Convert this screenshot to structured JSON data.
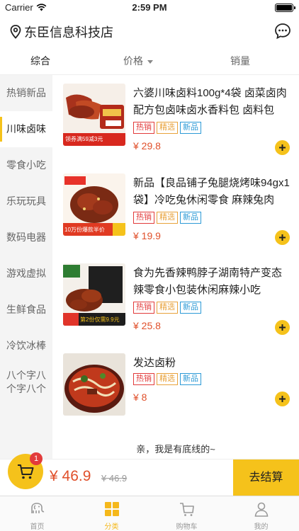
{
  "status": {
    "carrier": "Carrier",
    "time": "2:59 PM"
  },
  "header": {
    "store_name": "东臣信息科技店"
  },
  "sort_tabs": [
    {
      "label": "综合"
    },
    {
      "label": "价格"
    },
    {
      "label": "销量"
    }
  ],
  "categories": [
    {
      "label": "热销新品"
    },
    {
      "label": "川味卤味"
    },
    {
      "label": "零食小吃"
    },
    {
      "label": "乐玩玩具"
    },
    {
      "label": "数码电器"
    },
    {
      "label": "游戏虚拟"
    },
    {
      "label": "生鲜食品"
    },
    {
      "label": "冷饮冰棒"
    },
    {
      "label": "八个字八个字八个"
    }
  ],
  "active_category": "川味卤味",
  "tags": {
    "hot": "热销",
    "select": "精选",
    "new": "新品"
  },
  "products": [
    {
      "name": "六婆川味卤料100g*4袋 卤菜卤肉配方包卤味卤水香料包 卤料包",
      "price": "¥ 29.8",
      "image_text": "领券满59减3元"
    },
    {
      "name": "新品【良品铺子兔腿烧烤味94gx1袋】冷吃兔休闲零食 麻辣兔肉",
      "price": "¥ 19.9",
      "image_text": "10万份爆款半价"
    },
    {
      "name": "食为先香辣鸭脖子湖南特产变态辣零食小包装休闲麻辣小吃",
      "price": "¥ 25.8",
      "image_text": "第2份仅需9.9元"
    },
    {
      "name": "发达卤粉",
      "price": "¥ 8",
      "image_text": ""
    }
  ],
  "end_note": "亲，我是有底线的~",
  "checkout": {
    "badge": "1",
    "total": "¥ 46.9",
    "original": "¥ 46.9",
    "pay_label": "去结算"
  },
  "tabbar": [
    {
      "label": "首页"
    },
    {
      "label": "分类"
    },
    {
      "label": "购物车"
    },
    {
      "label": "我的"
    }
  ],
  "colors": {
    "accent": "#f5c21b",
    "price": "#e0502b",
    "hot": "#e23b3b",
    "select": "#e8a23b",
    "new": "#2d9ad6"
  }
}
